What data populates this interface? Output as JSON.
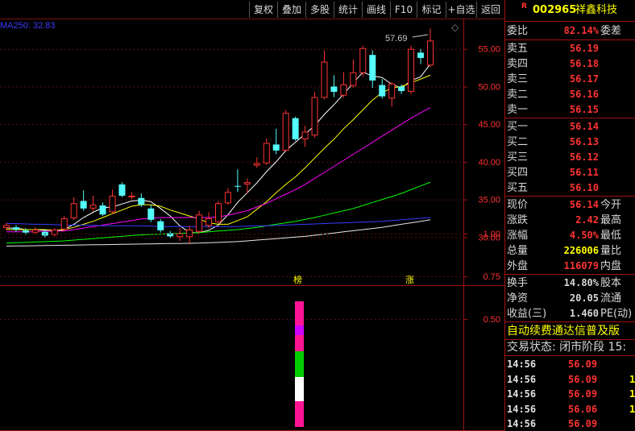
{
  "toolbar": {
    "buttons": [
      "复权",
      "叠加",
      "多股",
      "统计",
      "画线",
      "F10",
      "标记",
      "+自选",
      "返回"
    ]
  },
  "chart": {
    "ma_label": "MA250: 32.83",
    "high_label": "57.69",
    "tag_bang": "榜",
    "tag_zhang": "涨",
    "y_ticks": [
      "55.00",
      "50.00",
      "45.00",
      "40.00",
      "35.00",
      "30.00"
    ],
    "sub_ticks": [
      "1.00",
      "0.75",
      "0.50"
    ],
    "colors": {
      "up": "#ff3232",
      "down": "#54fcfc",
      "ma5": "#ffffff",
      "ma10": "#ffff00",
      "ma20": "#ff00ff",
      "ma60": "#00ff00",
      "ma120": "#3b3bff",
      "ma250": "#e8e8e8",
      "magenta": "#ff1493",
      "green": "#00cc00"
    }
  },
  "chart_data": {
    "type": "candlestick",
    "ylim": [
      28,
      58.5
    ],
    "candles": [
      {
        "o": 31.2,
        "c": 31.6,
        "h": 31.9,
        "l": 30.9
      },
      {
        "o": 31.3,
        "c": 31.0,
        "h": 31.6,
        "l": 30.7
      },
      {
        "o": 30.9,
        "c": 30.6,
        "h": 31.2,
        "l": 30.3
      },
      {
        "o": 30.6,
        "c": 31.0,
        "h": 31.3,
        "l": 30.4
      },
      {
        "o": 30.7,
        "c": 30.2,
        "h": 31.0,
        "l": 30.0
      },
      {
        "o": 30.3,
        "c": 31.0,
        "h": 31.2,
        "l": 30.1
      },
      {
        "o": 31.0,
        "c": 32.5,
        "h": 32.8,
        "l": 30.8
      },
      {
        "o": 32.5,
        "c": 34.5,
        "h": 35.3,
        "l": 32.3
      },
      {
        "o": 34.8,
        "c": 33.8,
        "h": 36.2,
        "l": 33.5
      },
      {
        "o": 33.8,
        "c": 34.3,
        "h": 35.5,
        "l": 33.4
      },
      {
        "o": 34.2,
        "c": 33.0,
        "h": 34.6,
        "l": 32.8
      },
      {
        "o": 33.3,
        "c": 35.5,
        "h": 36.3,
        "l": 33.1
      },
      {
        "o": 37.0,
        "c": 35.5,
        "h": 37.3,
        "l": 35.3
      },
      {
        "o": 35.3,
        "c": 35.5,
        "h": 36.0,
        "l": 35.0
      },
      {
        "o": 35.2,
        "c": 34.3,
        "h": 35.8,
        "l": 34.0
      },
      {
        "o": 33.8,
        "c": 32.3,
        "h": 34.3,
        "l": 32.0
      },
      {
        "o": 32.1,
        "c": 30.9,
        "h": 32.4,
        "l": 30.6
      },
      {
        "o": 30.5,
        "c": 30.1,
        "h": 30.8,
        "l": 29.9
      },
      {
        "o": 30.0,
        "c": 30.5,
        "h": 31.2,
        "l": 29.5
      },
      {
        "o": 30.0,
        "c": 31.0,
        "h": 31.5,
        "l": 29.0
      },
      {
        "o": 30.7,
        "c": 33.0,
        "h": 33.5,
        "l": 30.5
      },
      {
        "o": 31.5,
        "c": 32.5,
        "h": 33.3,
        "l": 31.2
      },
      {
        "o": 32.0,
        "c": 34.5,
        "h": 34.8,
        "l": 31.8
      },
      {
        "o": 34.5,
        "c": 36.0,
        "h": 36.5,
        "l": 34.3
      },
      {
        "o": 36.8,
        "c": 36.7,
        "h": 39.0,
        "l": 36.0
      },
      {
        "o": 37.0,
        "c": 37.3,
        "h": 37.8,
        "l": 35.8
      },
      {
        "o": 39.5,
        "c": 39.8,
        "h": 40.6,
        "l": 39.2
      },
      {
        "o": 39.8,
        "c": 42.5,
        "h": 43.1,
        "l": 39.6
      },
      {
        "o": 42.3,
        "c": 41.5,
        "h": 44.4,
        "l": 41.0
      },
      {
        "o": 41.5,
        "c": 46.5,
        "h": 46.9,
        "l": 41.3
      },
      {
        "o": 45.8,
        "c": 43.0,
        "h": 46.0,
        "l": 42.8
      },
      {
        "o": 43.0,
        "c": 44.0,
        "h": 44.8,
        "l": 42.0
      },
      {
        "o": 43.5,
        "c": 48.6,
        "h": 49.3,
        "l": 43.2
      },
      {
        "o": 48.5,
        "c": 53.3,
        "h": 54.8,
        "l": 48.3
      },
      {
        "o": 50.0,
        "c": 49.3,
        "h": 51.5,
        "l": 48.6
      },
      {
        "o": 48.8,
        "c": 50.3,
        "h": 51.9,
        "l": 48.5
      },
      {
        "o": 50.1,
        "c": 51.9,
        "h": 53.6,
        "l": 49.8
      },
      {
        "o": 51.8,
        "c": 55.1,
        "h": 55.4,
        "l": 51.3
      },
      {
        "o": 54.2,
        "c": 50.8,
        "h": 54.8,
        "l": 49.8
      },
      {
        "o": 50.2,
        "c": 48.7,
        "h": 51.0,
        "l": 48.4
      },
      {
        "o": 48.4,
        "c": 50.4,
        "h": 50.6,
        "l": 47.3
      },
      {
        "o": 50.0,
        "c": 49.4,
        "h": 50.3,
        "l": 49.0
      },
      {
        "o": 49.3,
        "c": 55.0,
        "h": 55.4,
        "l": 49.0
      },
      {
        "o": 54.5,
        "c": 53.8,
        "h": 55.0,
        "l": 53.0
      },
      {
        "o": 52.8,
        "c": 56.1,
        "h": 57.7,
        "l": 52.6
      }
    ],
    "ma_series": [
      {
        "color": "#ffffff",
        "values": [
          31.2,
          31.2,
          31.0,
          31.0,
          30.9,
          30.7,
          31.0,
          31.7,
          32.6,
          33.3,
          33.9,
          34.0,
          34.4,
          34.8,
          34.9,
          34.7,
          33.8,
          32.8,
          31.5,
          30.6,
          30.6,
          30.9,
          31.6,
          33.0,
          34.6,
          35.9,
          37.2,
          38.7,
          40.0,
          41.5,
          42.6,
          43.7,
          44.8,
          46.3,
          47.6,
          49.0,
          50.5,
          51.9,
          51.4,
          51.2,
          50.3,
          49.8,
          50.8,
          51.3,
          53.0
        ]
      },
      {
        "color": "#ffff00",
        "values": [
          31.0,
          31.0,
          31.0,
          31.0,
          31.0,
          30.9,
          31.0,
          31.3,
          31.7,
          32.1,
          32.6,
          33.1,
          33.6,
          34.1,
          34.3,
          34.3,
          34.1,
          33.6,
          33.2,
          32.8,
          32.4,
          31.9,
          31.7,
          31.7,
          32.2,
          32.7,
          33.7,
          34.7,
          35.9,
          37.0,
          38.0,
          39.2,
          40.5,
          41.8,
          43.0,
          44.4,
          45.6,
          46.9,
          48.2,
          49.2,
          49.8,
          50.0,
          50.5,
          51.0,
          51.5
        ]
      },
      {
        "color": "#ff00ff",
        "values": [
          30.7,
          30.7,
          30.7,
          30.7,
          30.8,
          30.8,
          30.8,
          31.0,
          31.2,
          31.4,
          31.6,
          31.8,
          32.0,
          32.2,
          32.4,
          32.5,
          32.6,
          32.6,
          32.6,
          32.6,
          32.6,
          32.6,
          32.7,
          32.9,
          33.2,
          33.5,
          34.0,
          34.5,
          35.1,
          35.7,
          36.3,
          37.0,
          37.8,
          38.6,
          39.4,
          40.2,
          41.0,
          41.8,
          42.6,
          43.4,
          44.2,
          45.0,
          45.8,
          46.5,
          47.2
        ]
      },
      {
        "color": "#00ff00",
        "values": [
          29.2,
          29.25,
          29.3,
          29.35,
          29.4,
          29.45,
          29.5,
          29.6,
          29.7,
          29.8,
          29.9,
          30.0,
          30.1,
          30.2,
          30.3,
          30.35,
          30.4,
          30.45,
          30.5,
          30.55,
          30.6,
          30.7,
          30.8,
          30.9,
          31.0,
          31.15,
          31.3,
          31.5,
          31.7,
          31.9,
          32.1,
          32.35,
          32.6,
          32.9,
          33.2,
          33.5,
          33.8,
          34.2,
          34.6,
          35.0,
          35.4,
          35.8,
          36.3,
          36.8,
          37.3
        ]
      },
      {
        "color": "#3b3bff",
        "values": [
          31.8,
          31.8,
          31.75,
          31.7,
          31.7,
          31.65,
          31.6,
          31.6,
          31.6,
          31.55,
          31.5,
          31.5,
          31.5,
          31.5,
          31.5,
          31.45,
          31.4,
          31.4,
          31.4,
          31.4,
          31.4,
          31.4,
          31.4,
          31.4,
          31.4,
          31.45,
          31.5,
          31.5,
          31.55,
          31.6,
          31.65,
          31.7,
          31.75,
          31.8,
          31.85,
          31.9,
          31.95,
          32.0,
          32.05,
          32.1,
          32.2,
          32.3,
          32.4,
          32.5,
          32.6
        ]
      },
      {
        "color": "#e8e8e8",
        "values": [
          28.8,
          28.82,
          28.84,
          28.86,
          28.88,
          28.9,
          28.92,
          28.94,
          28.96,
          28.98,
          29.0,
          29.02,
          29.04,
          29.06,
          29.08,
          29.1,
          29.12,
          29.14,
          29.16,
          29.18,
          29.2,
          29.25,
          29.3,
          29.35,
          29.4,
          29.5,
          29.6,
          29.7,
          29.8,
          29.9,
          30.0,
          30.1,
          30.25,
          30.4,
          30.55,
          30.7,
          30.85,
          31.0,
          31.15,
          31.3,
          31.5,
          31.7,
          31.9,
          32.1,
          32.3
        ]
      }
    ]
  },
  "quote": {
    "code": "002965",
    "name": "祥鑫科技",
    "r_mark": "R",
    "ratio_label": "委比",
    "ratio_value": "82.14%",
    "ratio_right": "委差",
    "asks": [
      {
        "label": "卖五",
        "price": "56.19"
      },
      {
        "label": "卖四",
        "price": "56.18"
      },
      {
        "label": "卖三",
        "price": "56.17"
      },
      {
        "label": "卖二",
        "price": "56.16"
      },
      {
        "label": "卖一",
        "price": "56.15"
      }
    ],
    "bids": [
      {
        "label": "买一",
        "price": "56.14"
      },
      {
        "label": "买二",
        "price": "56.13"
      },
      {
        "label": "买三",
        "price": "56.12"
      },
      {
        "label": "买四",
        "price": "56.11"
      },
      {
        "label": "买五",
        "price": "56.10"
      }
    ],
    "stats": [
      {
        "label": "现价",
        "value": "56.14",
        "right": "今开",
        "color": "#ff3232"
      },
      {
        "label": "涨跌",
        "value": "2.42",
        "right": "最高",
        "color": "#ff3232"
      },
      {
        "label": "涨幅",
        "value": "4.50%",
        "right": "最低",
        "color": "#ff3232"
      },
      {
        "label": "总量",
        "value": "226006",
        "right": "量比",
        "color": "#ffff00"
      },
      {
        "label": "外盘",
        "value": "116079",
        "right": "内盘",
        "color": "#ff3232"
      }
    ],
    "stats2": [
      {
        "label": "换手",
        "value": "14.80%",
        "right": "股本",
        "color": "#d8d8d8"
      },
      {
        "label": "净资",
        "value": "20.05",
        "right": "流通",
        "color": "#d8d8d8"
      },
      {
        "label": "收益(三)",
        "value": "1.460",
        "right": "PE(动)",
        "color": "#d8d8d8"
      }
    ],
    "news": "自动续费通达信普及版",
    "trade_status": "交易状态: 闭市阶段 15:",
    "ticks": [
      {
        "time": "14:56",
        "price": "56.09",
        "vol": ""
      },
      {
        "time": "14:56",
        "price": "56.09",
        "vol": "1"
      },
      {
        "time": "14:56",
        "price": "56.09",
        "vol": "1"
      },
      {
        "time": "14:56",
        "price": "56.06",
        "vol": "1"
      },
      {
        "time": "14:56",
        "price": "56.09",
        "vol": ""
      }
    ]
  }
}
